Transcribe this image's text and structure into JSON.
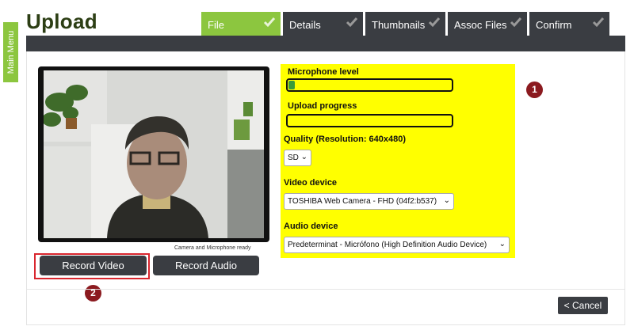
{
  "sidebar": {
    "main_menu_label": "Main Menu"
  },
  "header": {
    "title": "Upload"
  },
  "tabs": [
    {
      "label": "File",
      "active": true,
      "completed": true
    },
    {
      "label": "Details",
      "active": false,
      "completed": true
    },
    {
      "label": "Thumbnails",
      "active": false,
      "completed": true
    },
    {
      "label": "Assoc Files",
      "active": false,
      "completed": true
    },
    {
      "label": "Confirm",
      "active": false,
      "completed": true
    }
  ],
  "camera": {
    "status": "Camera and Microphone ready"
  },
  "actions": {
    "record_video": "Record Video",
    "record_audio": "Record Audio"
  },
  "settings": {
    "microphone_level_label": "Microphone level",
    "microphone_level": 0.04,
    "upload_progress_label": "Upload progress",
    "upload_progress": 0,
    "quality_label": "Quality (Resolution: 640x480)",
    "quality_value": "SD",
    "video_device_label": "Video device",
    "video_device_value": "TOSHIBA Web Camera - FHD (04f2:b537)",
    "audio_device_label": "Audio device",
    "audio_device_value": "Predeterminat - Micrófono (High Definition Audio Device)"
  },
  "callouts": {
    "one": "1",
    "two": "2"
  },
  "footer": {
    "cancel_label": "< Cancel"
  },
  "colors": {
    "accent_green": "#8cc63f",
    "dark": "#3a3d42",
    "highlight_yellow": "#ffff00",
    "callout_red": "#8b1a1f"
  }
}
